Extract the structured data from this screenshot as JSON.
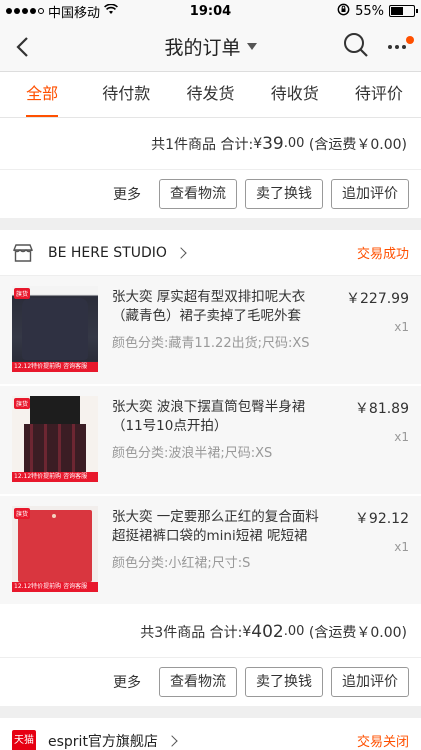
{
  "status_bar": {
    "carrier": "中国移动",
    "time": "19:04",
    "battery": "55%",
    "battery_level": 0.55
  },
  "nav": {
    "title": "我的订单"
  },
  "tabs": [
    {
      "label": "全部",
      "active": true
    },
    {
      "label": "待付款"
    },
    {
      "label": "待发货"
    },
    {
      "label": "待收货"
    },
    {
      "label": "待评价"
    }
  ],
  "order_prev": {
    "summary": {
      "count_text": "共1件商品",
      "total_label": "合计:",
      "currency": "¥",
      "amount_int": "39",
      "amount_dec": ".00",
      "shipping": "(含运费￥0.00)"
    },
    "actions": {
      "more": "更多",
      "logistics": "查看物流",
      "resell": "卖了换钱",
      "review": "追加评价"
    }
  },
  "order_main": {
    "shop": {
      "name": "BE HERE STUDIO",
      "status": "交易成功",
      "status_color": "#ff5000"
    },
    "items": [
      {
        "title": "张大奕 厚实超有型双排扣呢大衣（藏青色）裙子卖掉了毛呢外套",
        "sku": "颜色分类:藏青11.22出货;尺码:XS",
        "price": "￥227.99",
        "qty": "x1",
        "tag": "旗货",
        "band": "12.12特价提前购 咨询客服"
      },
      {
        "title": "张大奕 波浪下摆直筒包臀半身裙（11号10点开拍）",
        "sku": "颜色分类:波浪半裙;尺码:XS",
        "price": "￥81.89",
        "qty": "x1",
        "tag": "旗货",
        "band": "12.12特价提前购 咨询客服"
      },
      {
        "title": "张大奕 一定要那么正红的复合面料超挺裙裤口袋的mini短裙 呢短裙",
        "sku": "颜色分类:小红裙;尺寸:S",
        "price": "￥92.12",
        "qty": "x1",
        "tag": "旗货",
        "band": "12.12特价提前购 咨询客服"
      }
    ],
    "summary": {
      "count_text": "共3件商品",
      "total_label": "合计:",
      "currency": "¥",
      "amount_int": "402",
      "amount_dec": ".00",
      "shipping": "(含运费￥0.00)"
    },
    "actions": {
      "more": "更多",
      "logistics": "查看物流",
      "resell": "卖了换钱",
      "review": "追加评价"
    }
  },
  "order_next": {
    "shop": {
      "logo_text": "天猫",
      "name": "esprit官方旗舰店",
      "status": "交易关闭"
    }
  },
  "colors": {
    "accent": "#ff5000",
    "bg": "#efefef"
  }
}
